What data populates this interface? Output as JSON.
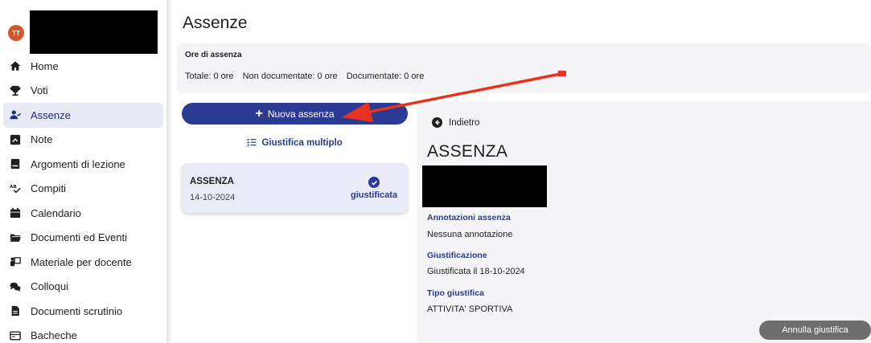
{
  "user": {
    "initials": "TT"
  },
  "sidebar": {
    "items": [
      {
        "label": "Home",
        "icon": "home-icon"
      },
      {
        "label": "Voti",
        "icon": "trophy-icon"
      },
      {
        "label": "Assenze",
        "icon": "user-check-icon",
        "active": true
      },
      {
        "label": "Note",
        "icon": "note-icon"
      },
      {
        "label": "Argomenti di lezione",
        "icon": "book-icon"
      },
      {
        "label": "Compiti",
        "icon": "spellcheck-icon"
      },
      {
        "label": "Calendario",
        "icon": "calendar-icon"
      },
      {
        "label": "Documenti ed Eventi",
        "icon": "folder-icon"
      },
      {
        "label": "Materiale per docente",
        "icon": "chalkboard-icon"
      },
      {
        "label": "Colloqui",
        "icon": "comments-icon"
      },
      {
        "label": "Documenti scrutinio",
        "icon": "file-icon"
      },
      {
        "label": "Bacheche",
        "icon": "board-icon"
      }
    ]
  },
  "page": {
    "title": "Assenze"
  },
  "summary": {
    "heading": "Ore di assenza",
    "totale": "Totale: 0 ore",
    "non_documentate": "Non documentate: 0 ore",
    "documentate": "Documentate: 0 ore"
  },
  "actions": {
    "new_absence": "Nuova assenza",
    "justify_multiple": "Giustifica multiplo"
  },
  "absence_card": {
    "title": "ASSENZA",
    "date": "14-10-2024",
    "status": "giustificata"
  },
  "detail": {
    "back": "Indietro",
    "title": "ASSENZA",
    "annotations_label": "Annotazioni assenza",
    "annotations_value": "Nessuna annotazione",
    "justification_label": "Giustificazione",
    "justification_value": "Giustificata il 18-10-2024",
    "type_label": "Tipo giustifica",
    "type_value": "ATTIVITA' SPORTIVA",
    "cancel_button": "Annulla giustifica"
  },
  "colors": {
    "primary": "#2b3a92",
    "annotation_arrow": "#e8321e",
    "avatar": "#d4562a"
  }
}
